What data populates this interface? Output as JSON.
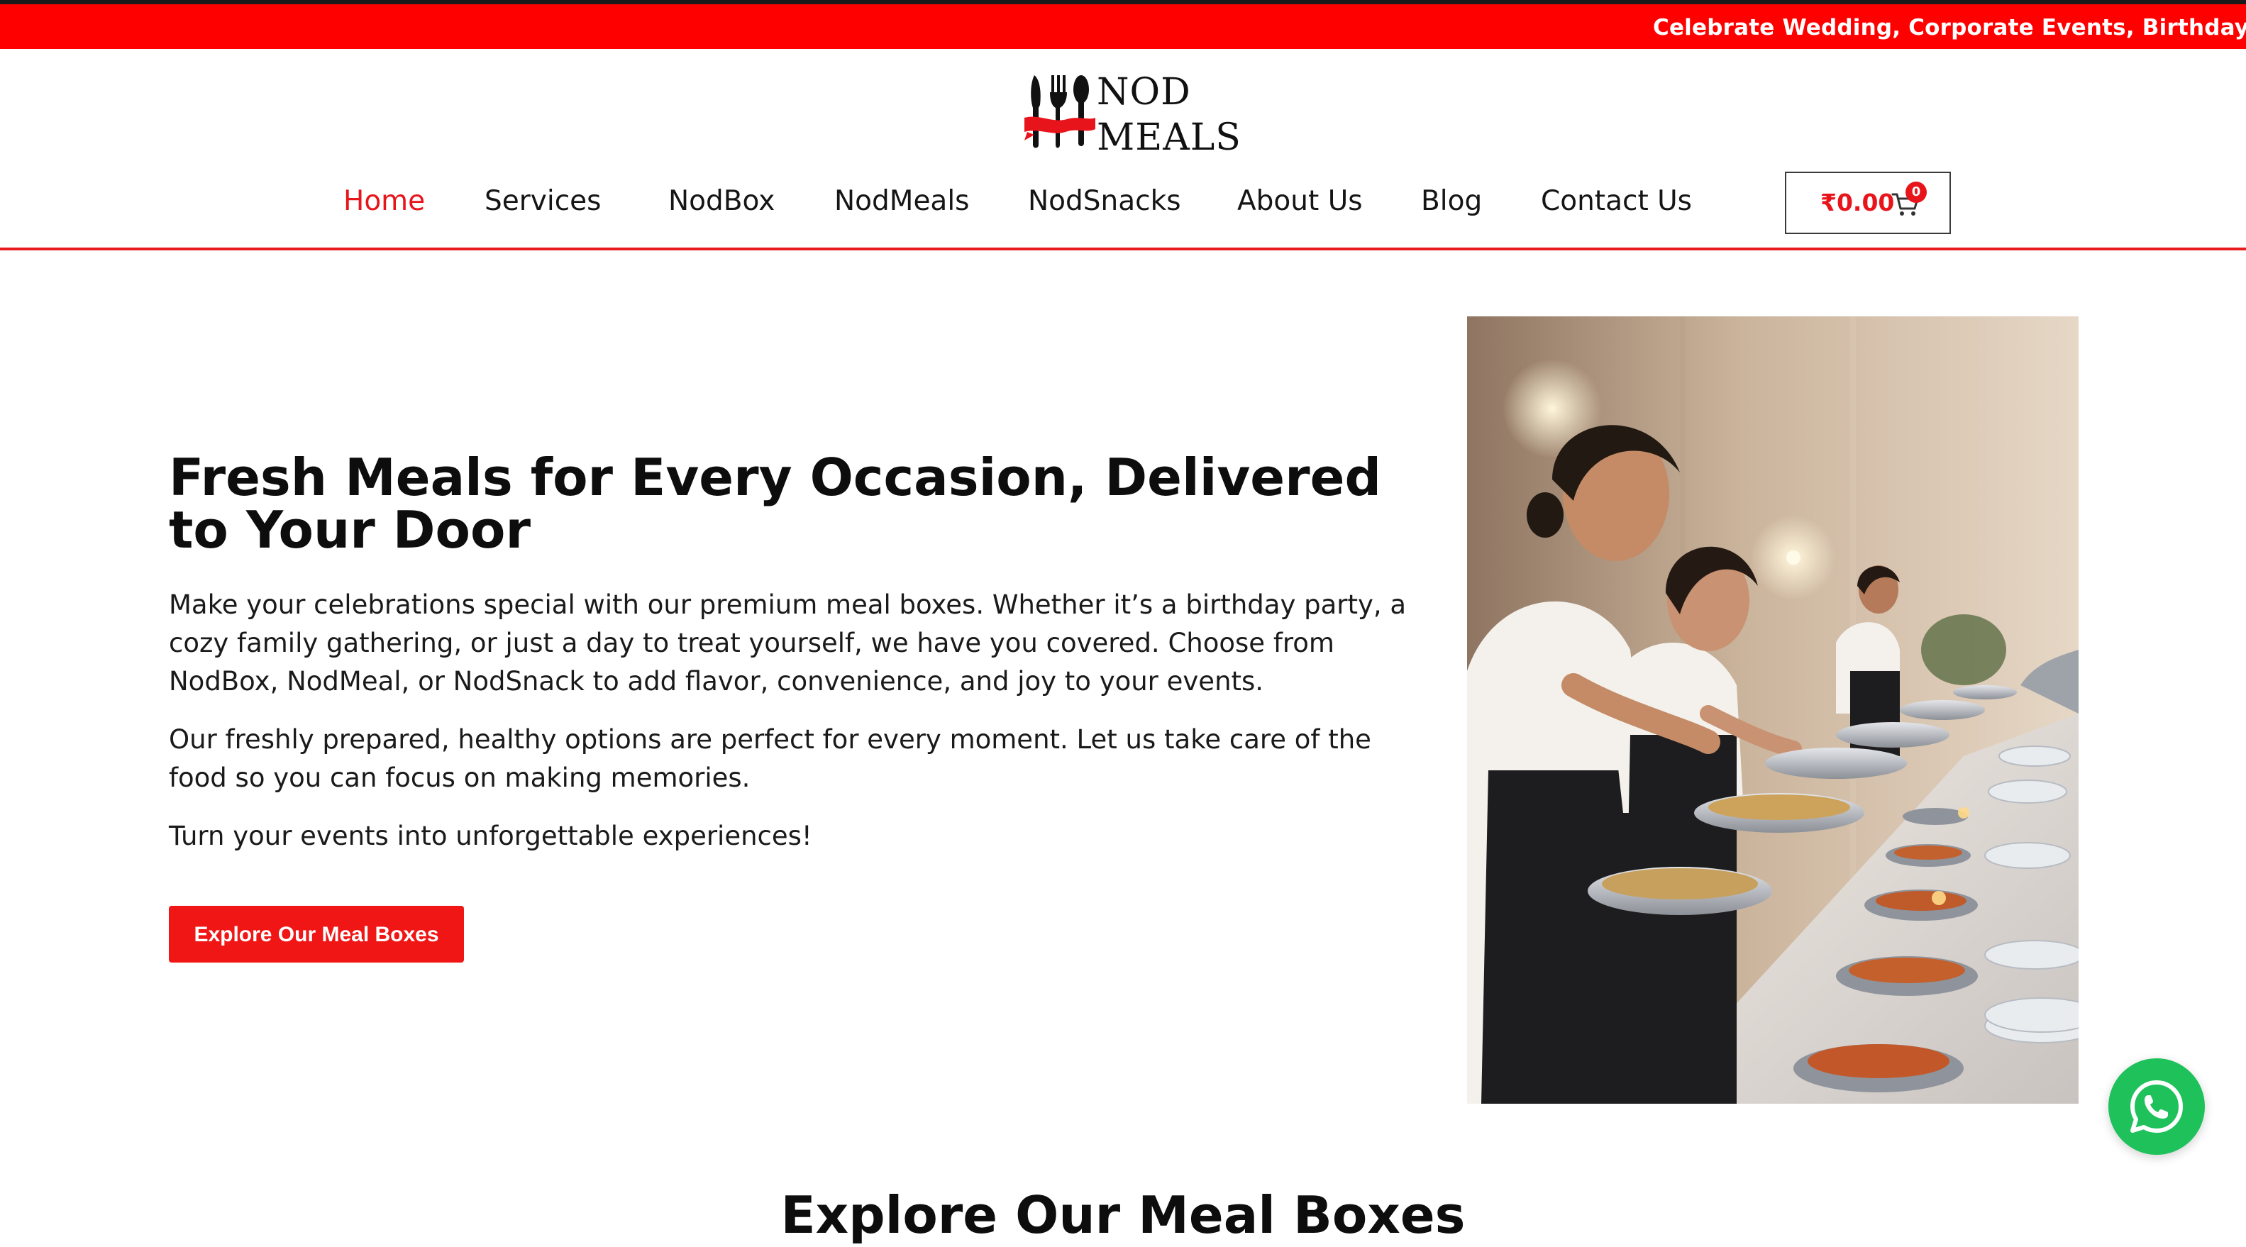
{
  "announcement": {
    "text": "Celebrate Wedding, Corporate Events, Birthday Par"
  },
  "logo": {
    "line1": "NOD",
    "line2": "MEALS",
    "icon": "fork-knife-icon"
  },
  "nav": {
    "items": [
      {
        "label": "Home",
        "active": true
      },
      {
        "label": "Services",
        "active": false
      },
      {
        "label": "NodBox",
        "active": false
      },
      {
        "label": "NodMeals",
        "active": false
      },
      {
        "label": "NodSnacks",
        "active": false
      },
      {
        "label": "About Us",
        "active": false
      },
      {
        "label": "Blog",
        "active": false
      },
      {
        "label": "Contact Us",
        "active": false
      }
    ]
  },
  "cart": {
    "amount": "₹0.00",
    "count": "0",
    "icon": "cart-icon"
  },
  "hero": {
    "title": "Fresh Meals for Every Occasion, Delivered to Your Door",
    "paragraph1": "Make your celebrations special with our premium meal boxes. Whether it’s a birthday party, a cozy family gathering, or just a day to treat yourself, we have you covered. Choose from NodBox, NodMeal, or NodSnack to add flavor, convenience, and joy to your events.",
    "paragraph2": "Our freshly prepared, healthy options are perfect for every moment. Let us take care of the food so you can focus on making memories.",
    "paragraph3": "Turn your events into unforgettable experiences!",
    "cta_label": "Explore Our Meal Boxes"
  },
  "section": {
    "heading": "Explore Our Meal Boxes"
  },
  "whatsapp": {
    "icon": "whatsapp-icon"
  },
  "colors": {
    "brand_red": "#ff0000",
    "nav_active": "#e8141b",
    "button_red": "#f01616",
    "whatsapp_green": "#1fc15a"
  }
}
